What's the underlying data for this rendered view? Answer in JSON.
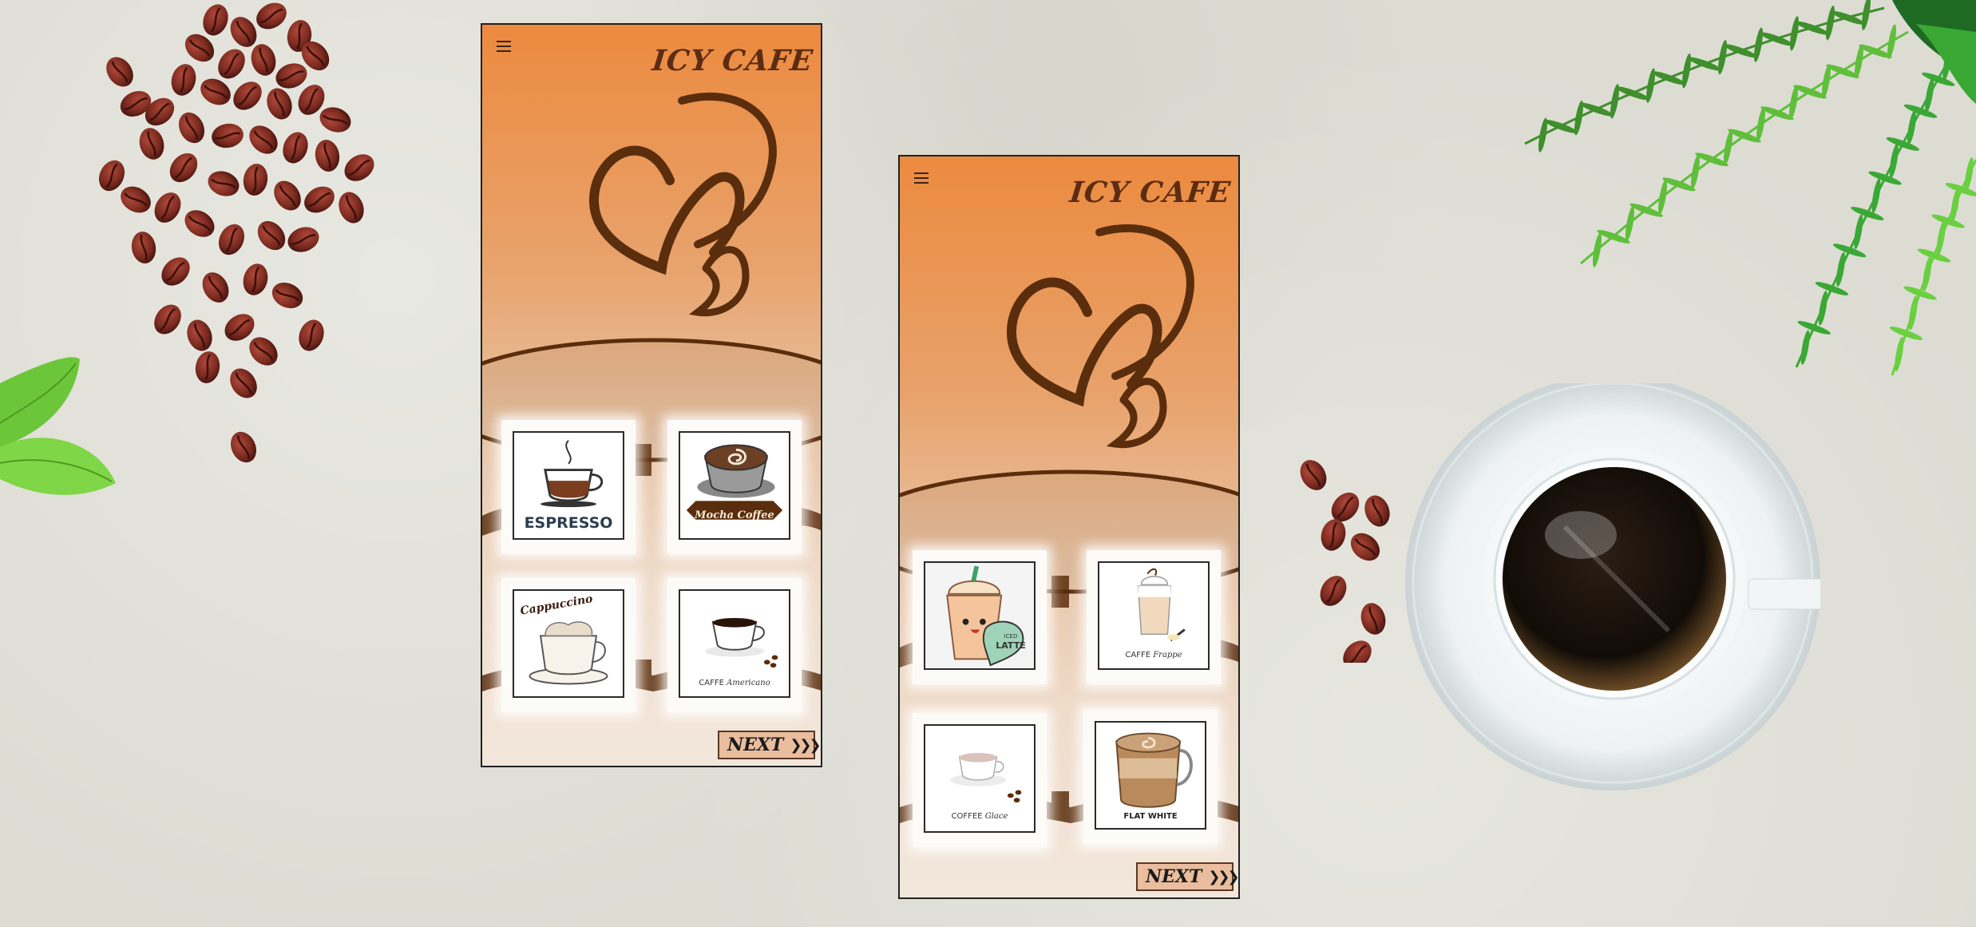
{
  "brand": "ICY CAFE",
  "colors": {
    "accent": "#ec8a3f",
    "brand_text": "#5b2c12",
    "button_bg": "#e9bd9e",
    "swirl": "#5a2d0c"
  },
  "screens": [
    {
      "menu_icon": "hamburger-menu-icon",
      "items": [
        {
          "name": "ESPRESSO",
          "icon": "espresso-cup-icon"
        },
        {
          "name": "Mocha Coffee",
          "icon": "mocha-coffee-icon"
        },
        {
          "name": "Cappuccino",
          "icon": "cappuccino-cup-icon"
        },
        {
          "name": "CAFFE",
          "name2": "Americano",
          "icon": "americano-cup-icon"
        }
      ],
      "next_label": "NEXT",
      "next_icon": "triple-chevron-right-icon"
    },
    {
      "menu_icon": "hamburger-menu-icon",
      "items": [
        {
          "name": "ICED",
          "name2": "LATTE",
          "icon": "iced-latte-cup-icon"
        },
        {
          "name": "CAFFE",
          "name2": "Frappe",
          "icon": "frappe-glass-icon"
        },
        {
          "name": "COFFEE",
          "name2": "Glace",
          "icon": "glace-cup-icon"
        },
        {
          "name": "FLAT WHITE",
          "icon": "flat-white-mug-icon"
        }
      ],
      "next_label": "NEXT",
      "next_icon": "triple-chevron-right-icon"
    }
  ]
}
